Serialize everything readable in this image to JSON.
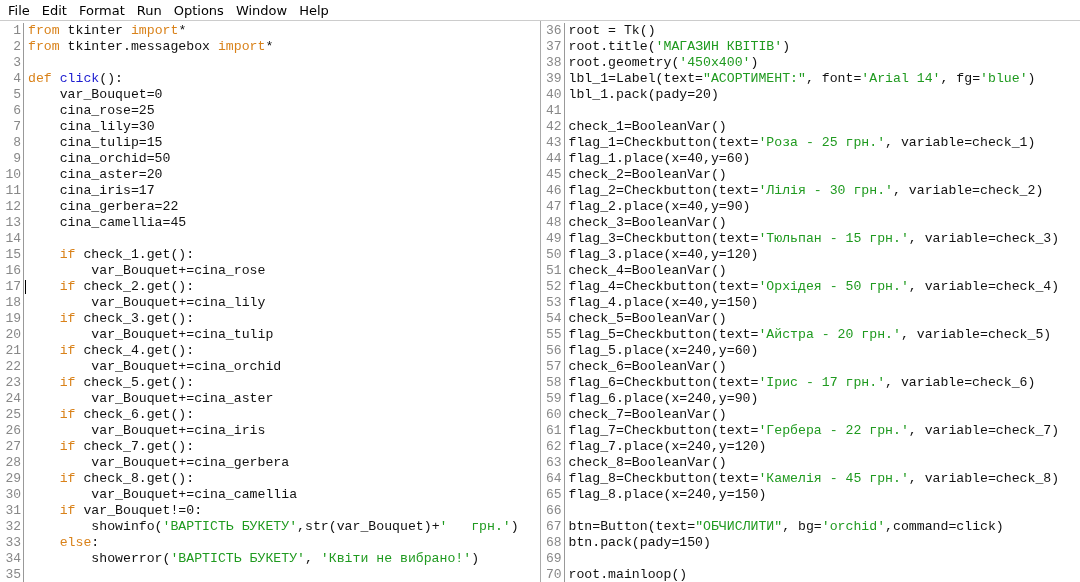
{
  "menu": [
    "File",
    "Edit",
    "Format",
    "Run",
    "Options",
    "Window",
    "Help"
  ],
  "panes": [
    {
      "lines": [
        {
          "number": "1",
          "parts": [
            {
              "kind": "keyword",
              "text": "from"
            },
            {
              "kind": "plain",
              "text": " tkinter "
            },
            {
              "kind": "keyword",
              "text": "import"
            },
            {
              "kind": "plain",
              "text": "*"
            }
          ]
        },
        {
          "number": "2",
          "parts": [
            {
              "kind": "keyword",
              "text": "from"
            },
            {
              "kind": "plain",
              "text": " tkinter.messagebox "
            },
            {
              "kind": "keyword",
              "text": "import"
            },
            {
              "kind": "plain",
              "text": "*"
            }
          ]
        },
        {
          "number": "3"
        },
        {
          "number": "4",
          "parts": [
            {
              "kind": "keyword",
              "text": "def "
            },
            {
              "kind": "definition",
              "text": "click"
            },
            {
              "kind": "plain",
              "text": "():"
            }
          ]
        },
        {
          "number": "5",
          "parts": [
            {
              "kind": "plain",
              "text": "    var_Bouquet=0"
            }
          ]
        },
        {
          "number": "6",
          "parts": [
            {
              "kind": "plain",
              "text": "    cina_rose=25"
            }
          ]
        },
        {
          "number": "7",
          "parts": [
            {
              "kind": "plain",
              "text": "    cina_lily=30"
            }
          ]
        },
        {
          "number": "8",
          "parts": [
            {
              "kind": "plain",
              "text": "    cina_tulip=15"
            }
          ]
        },
        {
          "number": "9",
          "parts": [
            {
              "kind": "plain",
              "text": "    cina_orchid=50"
            }
          ]
        },
        {
          "number": "10",
          "parts": [
            {
              "kind": "plain",
              "text": "    cina_aster=20"
            }
          ]
        },
        {
          "number": "11",
          "parts": [
            {
              "kind": "plain",
              "text": "    cina_iris=17"
            }
          ]
        },
        {
          "number": "12",
          "parts": [
            {
              "kind": "plain",
              "text": "    cina_gerbera=22"
            }
          ]
        },
        {
          "number": "13",
          "parts": [
            {
              "kind": "plain",
              "text": "    cina_camellia=45"
            }
          ]
        },
        {
          "number": "14"
        },
        {
          "number": "15",
          "parts": [
            {
              "kind": "keyword",
              "text": "    if"
            },
            {
              "kind": "plain",
              "text": " check_1.get():"
            }
          ]
        },
        {
          "number": "16",
          "parts": [
            {
              "kind": "plain",
              "text": "        var_Bouquet+=cina_rose"
            }
          ]
        },
        {
          "number": "17",
          "cursor": true,
          "parts": [
            {
              "kind": "keyword",
              "text": "    if"
            },
            {
              "kind": "plain",
              "text": " check_2.get():"
            }
          ]
        },
        {
          "number": "18",
          "parts": [
            {
              "kind": "plain",
              "text": "        var_Bouquet+=cina_lily"
            }
          ]
        },
        {
          "number": "19",
          "parts": [
            {
              "kind": "keyword",
              "text": "    if"
            },
            {
              "kind": "plain",
              "text": " check_3.get():"
            }
          ]
        },
        {
          "number": "20",
          "parts": [
            {
              "kind": "plain",
              "text": "        var_Bouquet+=cina_tulip"
            }
          ]
        },
        {
          "number": "21",
          "parts": [
            {
              "kind": "keyword",
              "text": "    if"
            },
            {
              "kind": "plain",
              "text": " check_4.get():"
            }
          ]
        },
        {
          "number": "22",
          "parts": [
            {
              "kind": "plain",
              "text": "        var_Bouquet+=cina_orchid"
            }
          ]
        },
        {
          "number": "23",
          "parts": [
            {
              "kind": "keyword",
              "text": "    if"
            },
            {
              "kind": "plain",
              "text": " check_5.get():"
            }
          ]
        },
        {
          "number": "24",
          "parts": [
            {
              "kind": "plain",
              "text": "        var_Bouquet+=cina_aster"
            }
          ]
        },
        {
          "number": "25",
          "parts": [
            {
              "kind": "keyword",
              "text": "    if"
            },
            {
              "kind": "plain",
              "text": " check_6.get():"
            }
          ]
        },
        {
          "number": "26",
          "parts": [
            {
              "kind": "plain",
              "text": "        var_Bouquet+=cina_iris"
            }
          ]
        },
        {
          "number": "27",
          "parts": [
            {
              "kind": "keyword",
              "text": "    if"
            },
            {
              "kind": "plain",
              "text": " check_7.get():"
            }
          ]
        },
        {
          "number": "28",
          "parts": [
            {
              "kind": "plain",
              "text": "        var_Bouquet+=cina_gerbera"
            }
          ]
        },
        {
          "number": "29",
          "parts": [
            {
              "kind": "keyword",
              "text": "    if"
            },
            {
              "kind": "plain",
              "text": " check_8.get():"
            }
          ]
        },
        {
          "number": "30",
          "parts": [
            {
              "kind": "plain",
              "text": "        var_Bouquet+=cina_camellia"
            }
          ]
        },
        {
          "number": "31",
          "parts": [
            {
              "kind": "keyword",
              "text": "    if"
            },
            {
              "kind": "plain",
              "text": " var_Bouquet!=0:"
            }
          ]
        },
        {
          "number": "32",
          "parts": [
            {
              "kind": "plain",
              "text": "        showinfo("
            },
            {
              "kind": "string",
              "text": "'ВАРТІСТЬ БУКЕТУ'"
            },
            {
              "kind": "plain",
              "text": ",str(var_Bouquet)+"
            },
            {
              "kind": "string",
              "text": "'   грн.'"
            },
            {
              "kind": "plain",
              "text": ")"
            }
          ]
        },
        {
          "number": "33",
          "parts": [
            {
              "kind": "keyword",
              "text": "    else"
            },
            {
              "kind": "plain",
              "text": ":"
            }
          ]
        },
        {
          "number": "34",
          "parts": [
            {
              "kind": "plain",
              "text": "        showerror("
            },
            {
              "kind": "string",
              "text": "'ВАРТІСТЬ БУКЕТУ'"
            },
            {
              "kind": "plain",
              "text": ", "
            },
            {
              "kind": "string",
              "text": "'Квіти не вибрано!'"
            },
            {
              "kind": "plain",
              "text": ")"
            }
          ]
        },
        {
          "number": "35"
        }
      ]
    },
    {
      "lines": [
        {
          "number": "36",
          "parts": [
            {
              "kind": "plain",
              "text": "root = Tk()"
            }
          ]
        },
        {
          "number": "37",
          "parts": [
            {
              "kind": "plain",
              "text": "root.title("
            },
            {
              "kind": "string",
              "text": "'МАГАЗИН КВІТІВ'"
            },
            {
              "kind": "plain",
              "text": ")"
            }
          ]
        },
        {
          "number": "38",
          "parts": [
            {
              "kind": "plain",
              "text": "root.geometry("
            },
            {
              "kind": "string",
              "text": "'450x400'"
            },
            {
              "kind": "plain",
              "text": ")"
            }
          ]
        },
        {
          "number": "39",
          "parts": [
            {
              "kind": "plain",
              "text": "lbl_1=Label(text="
            },
            {
              "kind": "string",
              "text": "\"АСОРТИМЕНТ:\""
            },
            {
              "kind": "plain",
              "text": ", font="
            },
            {
              "kind": "string",
              "text": "'Arial 14'"
            },
            {
              "kind": "plain",
              "text": ", fg="
            },
            {
              "kind": "string",
              "text": "'blue'"
            },
            {
              "kind": "plain",
              "text": ")"
            }
          ]
        },
        {
          "number": "40",
          "parts": [
            {
              "kind": "plain",
              "text": "lbl_1.pack(pady=20)"
            }
          ]
        },
        {
          "number": "41"
        },
        {
          "number": "42",
          "parts": [
            {
              "kind": "plain",
              "text": "check_1=BooleanVar()"
            }
          ]
        },
        {
          "number": "43",
          "parts": [
            {
              "kind": "plain",
              "text": "flag_1=Checkbutton(text="
            },
            {
              "kind": "string",
              "text": "'Роза - 25 грн.'"
            },
            {
              "kind": "plain",
              "text": ", variable=check_1)"
            }
          ]
        },
        {
          "number": "44",
          "parts": [
            {
              "kind": "plain",
              "text": "flag_1.place(x=40,y=60)"
            }
          ]
        },
        {
          "number": "45",
          "parts": [
            {
              "kind": "plain",
              "text": "check_2=BooleanVar()"
            }
          ]
        },
        {
          "number": "46",
          "parts": [
            {
              "kind": "plain",
              "text": "flag_2=Checkbutton(text="
            },
            {
              "kind": "string",
              "text": "'Лілія - 30 грн.'"
            },
            {
              "kind": "plain",
              "text": ", variable=check_2)"
            }
          ]
        },
        {
          "number": "47",
          "parts": [
            {
              "kind": "plain",
              "text": "flag_2.place(x=40,y=90)"
            }
          ]
        },
        {
          "number": "48",
          "parts": [
            {
              "kind": "plain",
              "text": "check_3=BooleanVar()"
            }
          ]
        },
        {
          "number": "49",
          "parts": [
            {
              "kind": "plain",
              "text": "flag_3=Checkbutton(text="
            },
            {
              "kind": "string",
              "text": "'Тюльпан - 15 грн.'"
            },
            {
              "kind": "plain",
              "text": ", variable=check_3)"
            }
          ]
        },
        {
          "number": "50",
          "parts": [
            {
              "kind": "plain",
              "text": "flag_3.place(x=40,y=120)"
            }
          ]
        },
        {
          "number": "51",
          "parts": [
            {
              "kind": "plain",
              "text": "check_4=BooleanVar()"
            }
          ]
        },
        {
          "number": "52",
          "parts": [
            {
              "kind": "plain",
              "text": "flag_4=Checkbutton(text="
            },
            {
              "kind": "string",
              "text": "'Орхідея - 50 грн.'"
            },
            {
              "kind": "plain",
              "text": ", variable=check_4)"
            }
          ]
        },
        {
          "number": "53",
          "parts": [
            {
              "kind": "plain",
              "text": "flag_4.place(x=40,y=150)"
            }
          ]
        },
        {
          "number": "54",
          "parts": [
            {
              "kind": "plain",
              "text": "check_5=BooleanVar()"
            }
          ]
        },
        {
          "number": "55",
          "parts": [
            {
              "kind": "plain",
              "text": "flag_5=Checkbutton(text="
            },
            {
              "kind": "string",
              "text": "'Айстра - 20 грн.'"
            },
            {
              "kind": "plain",
              "text": ", variable=check_5)"
            }
          ]
        },
        {
          "number": "56",
          "parts": [
            {
              "kind": "plain",
              "text": "flag_5.place(x=240,y=60)"
            }
          ]
        },
        {
          "number": "57",
          "parts": [
            {
              "kind": "plain",
              "text": "check_6=BooleanVar()"
            }
          ]
        },
        {
          "number": "58",
          "parts": [
            {
              "kind": "plain",
              "text": "flag_6=Checkbutton(text="
            },
            {
              "kind": "string",
              "text": "'Ірис - 17 грн.'"
            },
            {
              "kind": "plain",
              "text": ", variable=check_6)"
            }
          ]
        },
        {
          "number": "59",
          "parts": [
            {
              "kind": "plain",
              "text": "flag_6.place(x=240,y=90)"
            }
          ]
        },
        {
          "number": "60",
          "parts": [
            {
              "kind": "plain",
              "text": "check_7=BooleanVar()"
            }
          ]
        },
        {
          "number": "61",
          "parts": [
            {
              "kind": "plain",
              "text": "flag_7=Checkbutton(text="
            },
            {
              "kind": "string",
              "text": "'Гербера - 22 грн.'"
            },
            {
              "kind": "plain",
              "text": ", variable=check_7)"
            }
          ]
        },
        {
          "number": "62",
          "parts": [
            {
              "kind": "plain",
              "text": "flag_7.place(x=240,y=120)"
            }
          ]
        },
        {
          "number": "63",
          "parts": [
            {
              "kind": "plain",
              "text": "check_8=BooleanVar()"
            }
          ]
        },
        {
          "number": "64",
          "parts": [
            {
              "kind": "plain",
              "text": "flag_8=Checkbutton(text="
            },
            {
              "kind": "string",
              "text": "'Камелія - 45 грн.'"
            },
            {
              "kind": "plain",
              "text": ", variable=check_8)"
            }
          ]
        },
        {
          "number": "65",
          "parts": [
            {
              "kind": "plain",
              "text": "flag_8.place(x=240,y=150)"
            }
          ]
        },
        {
          "number": "66"
        },
        {
          "number": "67",
          "parts": [
            {
              "kind": "plain",
              "text": "btn=Button(text="
            },
            {
              "kind": "string",
              "text": "\"ОБЧИСЛИТИ\""
            },
            {
              "kind": "plain",
              "text": ", bg="
            },
            {
              "kind": "string",
              "text": "'orchid'"
            },
            {
              "kind": "plain",
              "text": ",command=click)"
            }
          ]
        },
        {
          "number": "68",
          "parts": [
            {
              "kind": "plain",
              "text": "btn.pack(pady=150)"
            }
          ]
        },
        {
          "number": "69"
        },
        {
          "number": "70",
          "parts": [
            {
              "kind": "plain",
              "text": "root.mainloop()"
            }
          ]
        }
      ]
    }
  ]
}
